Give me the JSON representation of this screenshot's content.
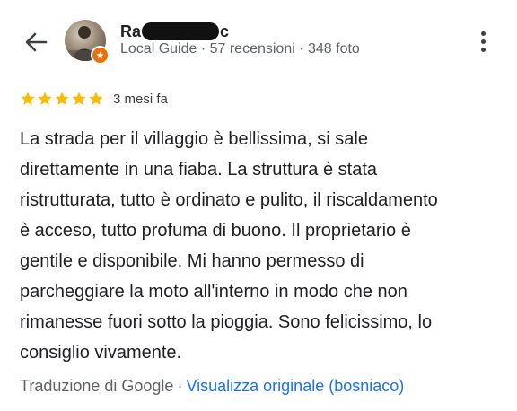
{
  "reviewer": {
    "name_start": "Ra",
    "name_end": "c",
    "meta": "Local Guide · 57 recensioni · 348 foto"
  },
  "review": {
    "rating": 5,
    "rating_max": 5,
    "date": "3 mesi fa",
    "lines": [
      "La strada per il villaggio è bellissima, si sale",
      "direttamente in una fiaba. La struttura è stata",
      "ristrutturata, tutto è ordinato e pulito, il riscaldamento",
      "è acceso, tutto profuma di buono. Il proprietario è",
      "gentile e disponibile. Mi hanno permesso di",
      "parcheggiare la moto all'interno in modo che non",
      "rimanesse fuori sotto la pioggia. Sono felicissimo, lo",
      "consiglio vivamente."
    ]
  },
  "translation": {
    "source": "Traduzione di Google",
    "separator": "·",
    "link": "Visualizza originale (bosniaco)"
  },
  "icons": {
    "back": "arrow-back-icon",
    "more": "more-vert-icon",
    "star": "star-icon",
    "badge": "local-guide-badge-icon"
  },
  "colors": {
    "star": "#fbbc04",
    "link": "#1a73e8",
    "badge": "#e8710a",
    "text": "#202124",
    "secondary": "#5f6368"
  }
}
